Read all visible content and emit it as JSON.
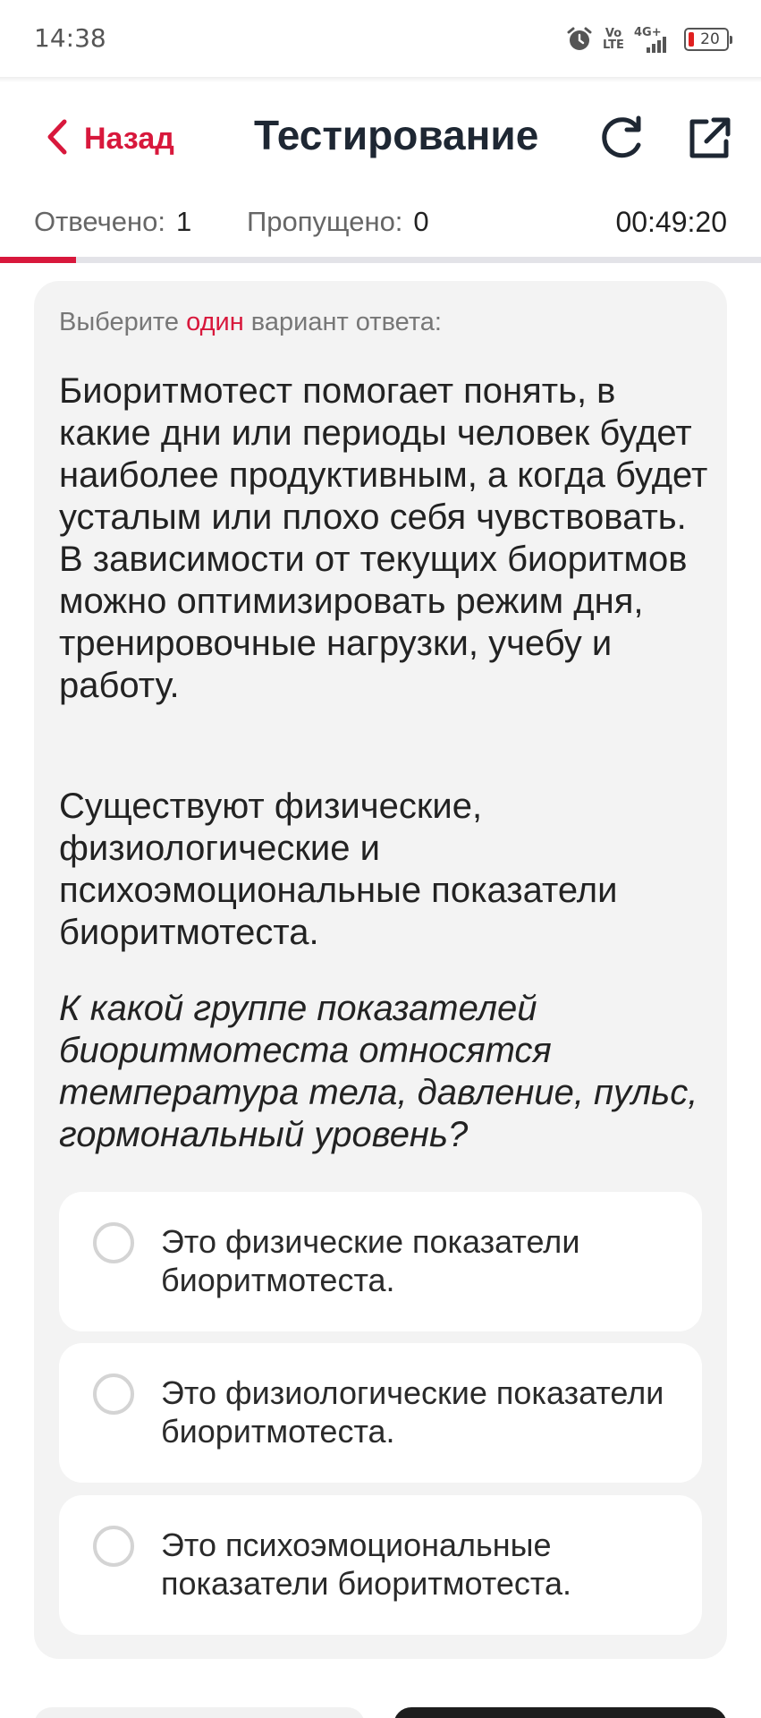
{
  "status_bar": {
    "time": "14:38",
    "network_label": "4G+",
    "volte_label": "Vo LTE",
    "battery_level": "20",
    "icons": [
      "alarm-icon",
      "volte-icon",
      "signal-icon",
      "battery-icon"
    ]
  },
  "header": {
    "back_label": "Назад",
    "title": "Тестирование",
    "icons": [
      "chevron-left-icon",
      "refresh-icon",
      "share-icon"
    ]
  },
  "stats": {
    "answered_label": "Отвечено:",
    "answered_value": "1",
    "skipped_label": "Пропущено:",
    "skipped_value": "0",
    "timer": "00:49:20"
  },
  "progress": {
    "fraction": 0.1
  },
  "question": {
    "instruction_before": "Выберите ",
    "instruction_accent": "один",
    "instruction_after": " вариант ответа:",
    "paragraph1": "Биоритмотест помогает понять, в какие дни или периоды человек будет наиболее продуктивным, а когда будет усталым или плохо себя чувствовать. В зависимости от текущих биоритмов можно оптимизировать режим дня, тренировочные нагрузки, учебу и работу.",
    "paragraph2": "Существуют физические, физиологические и психоэмоциональные показатели биоритмотеста.",
    "paragraph3": "К какой группе показателей биоритмотеста относятся температура тела, давление, пульс, гормональный уровень?"
  },
  "options": [
    {
      "label": "Это физические показатели биоритмотеста.",
      "selected": false
    },
    {
      "label": "Это физиологические показатели биоритмотеста.",
      "selected": false
    },
    {
      "label": "Это психоэмоциональные показатели биоритмотеста.",
      "selected": false
    }
  ],
  "colors": {
    "accent": "#d8183c",
    "title": "#1e2733",
    "card_bg": "#f3f3f3",
    "option_bg": "#ffffff",
    "radio_border": "#d4d4d4"
  }
}
